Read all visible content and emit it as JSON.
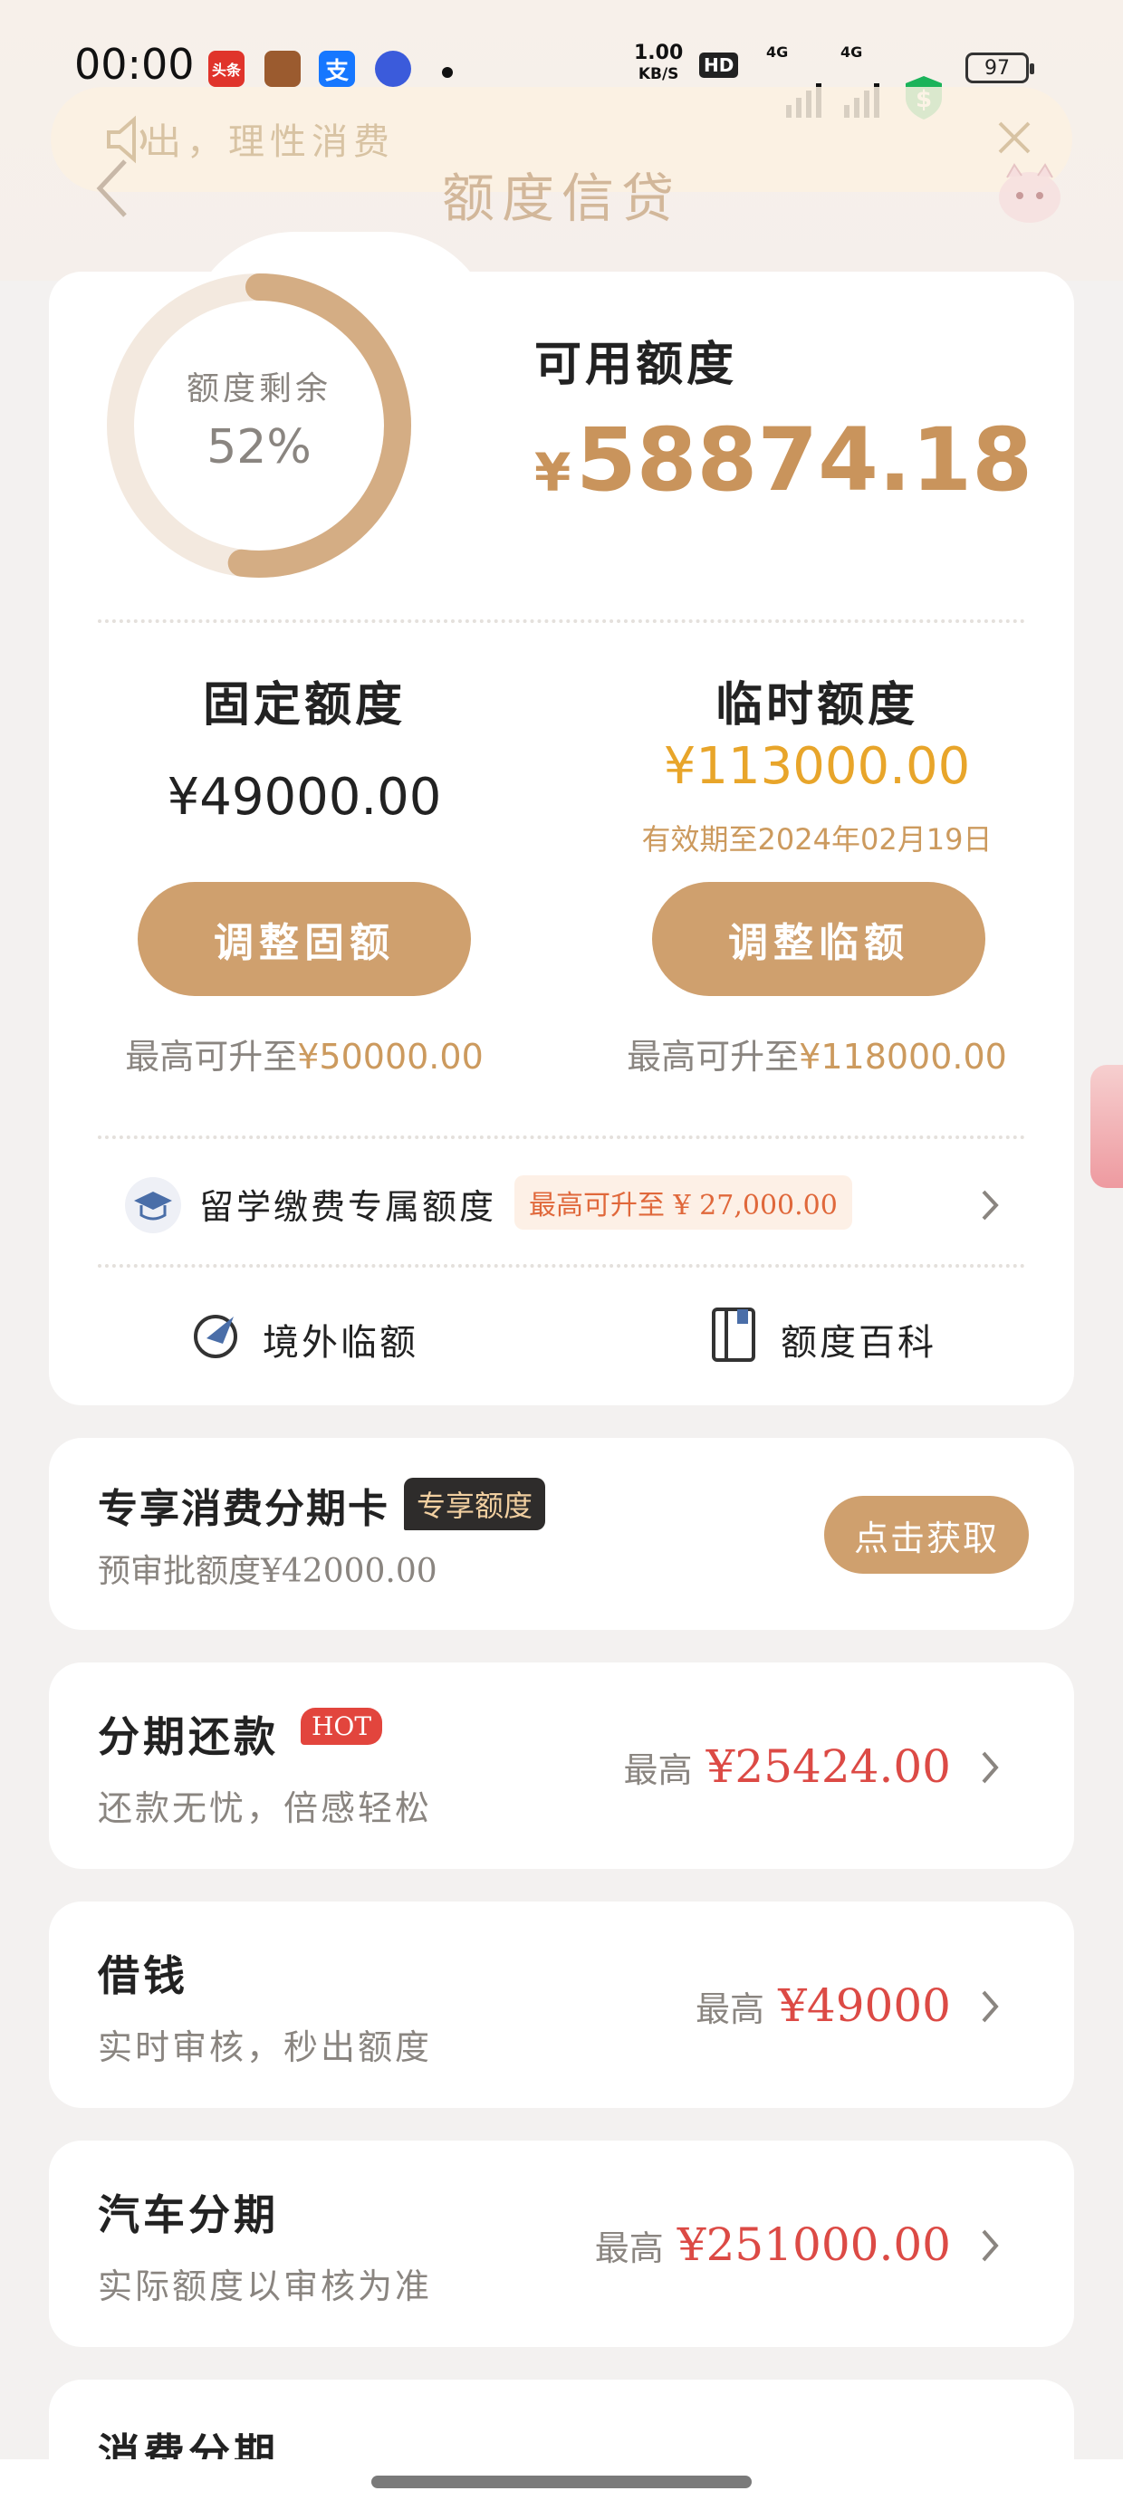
{
  "status_bar": {
    "time": "00:00",
    "apps": [
      "头条",
      "支"
    ],
    "net_speed": "1.00",
    "net_unit": "KB/S",
    "hd": "HD",
    "sig1": "4G",
    "sig2": "4G",
    "battery": "97"
  },
  "notice": {
    "text": "出，理性消费"
  },
  "nav": {
    "title": "额度信贷"
  },
  "credit": {
    "ring_label": "额度剩余",
    "ring_percent": "52%",
    "remaining_fraction": 0.52,
    "available_title": "可用额度",
    "currency": "¥",
    "available_amount": "58874.18",
    "fixed": {
      "title": "固定额度",
      "amount": "¥49000.00",
      "button": "调整固额",
      "max_note": "最高可升至",
      "max_amount": "¥50000.00"
    },
    "temp": {
      "title": "临时额度",
      "amount": "¥113000.00",
      "validity": "有效期至2024年02月19日",
      "button": "调整临额",
      "max_note": "最高可升至",
      "max_amount": "¥118000.00"
    },
    "study": {
      "label": "留学缴费专属额度",
      "badge": "最高可升至 ¥ 27,000.00"
    },
    "links": {
      "overseas": "境外临额",
      "wiki": "额度百科"
    }
  },
  "installment_card": {
    "title": "专享消费分期卡",
    "tag": "专享额度",
    "subtitle": "预审批额度¥42000.00",
    "button": "点击获取"
  },
  "products": [
    {
      "title": "分期还款",
      "badge": "HOT",
      "subtitle": "还款无忧，倍感轻松",
      "prefix": "最高",
      "amount": "¥25424.00"
    },
    {
      "title": "借钱",
      "subtitle": "实时审核，秒出额度",
      "prefix": "最高",
      "amount": "¥49000"
    },
    {
      "title": "汽车分期",
      "subtitle": "实际额度以审核为准",
      "prefix": "最高",
      "amount": "¥251000.00"
    },
    {
      "title": "消费分期"
    }
  ],
  "colors": {
    "gold": "#cfa06e",
    "ring_track": "#f3e9df",
    "red": "#dc4a45",
    "orange": "#e8a52a"
  }
}
